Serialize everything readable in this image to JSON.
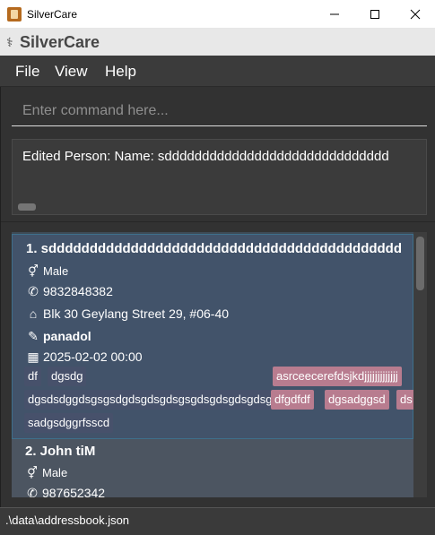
{
  "window": {
    "title": "SilverCare",
    "brand": "SilverCare",
    "controls": [
      "minimize",
      "maximize",
      "close"
    ]
  },
  "menu": {
    "file": "File",
    "view": "View",
    "help": "Help"
  },
  "command": {
    "placeholder": "Enter command here...",
    "value": ""
  },
  "result": {
    "text": "Edited Person: Name: sdddddddddddddddddddddddddddddd"
  },
  "persons": [
    {
      "title": "1. sddddddddddddddddddddddddddddddddddddddddddd",
      "gender": "Male",
      "phone": "9832848382",
      "address": "Blk 30 Geylang Street 29, #06-40",
      "medicine": "panadol",
      "appointment": "2025-02-02 00:00",
      "tags_row1": [
        "df",
        "dgsdg"
      ],
      "tags_row1_pink": [
        "asrceecerefdsjkdjjjjjjjjjjjjj"
      ],
      "tags_row2": [
        "dgsdsdggdsgsgsdgdsgdsgdsgsgdsgdsgdsgdsg"
      ],
      "tags_row2_pink": [
        "dfgdfdf",
        "dgsadggsd",
        "ds"
      ],
      "tags_row3": [
        "sadgsdggrfsscd"
      ]
    },
    {
      "title": "2. John tiM",
      "gender": "Male",
      "phone": "987652342"
    }
  ],
  "status": {
    "path": ".\\data\\addressbook.json"
  },
  "icons": {
    "gender": "gender-icon",
    "phone": "phone-icon",
    "address": "home-icon",
    "medicine": "pill-icon",
    "appointment": "calendar-icon"
  }
}
